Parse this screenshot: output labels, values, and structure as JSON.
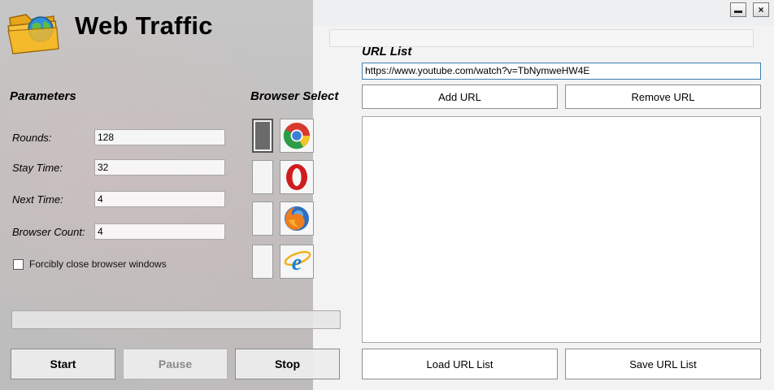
{
  "app": {
    "title": "Web Traffic"
  },
  "parameters": {
    "heading": "Parameters",
    "rounds_label": "Rounds:",
    "rounds_value": "128",
    "stay_label": "Stay Time:",
    "stay_value": "32",
    "next_label": "Next Time:",
    "next_value": "4",
    "count_label": "Browser Count:",
    "count_value": "4",
    "close_label": "Forcibly close browser windows",
    "close_checked": false
  },
  "progress": {
    "value": 0
  },
  "actions": {
    "start": "Start",
    "pause": "Pause",
    "stop": "Stop"
  },
  "browser_select": {
    "heading": "Browser Select",
    "browsers": [
      {
        "name": "Chrome",
        "icon": "chrome-icon",
        "selected": true
      },
      {
        "name": "Opera",
        "icon": "opera-icon",
        "selected": false
      },
      {
        "name": "Firefox",
        "icon": "firefox-icon",
        "selected": false
      },
      {
        "name": "Internet Explorer",
        "icon": "ie-icon",
        "selected": false
      }
    ]
  },
  "url_list": {
    "heading": "URL List",
    "input_value": "https://www.youtube.com/watch?v=TbNymweHW4E",
    "add": "Add URL",
    "remove": "Remove URL",
    "items": [],
    "load": "Load URL List",
    "save": "Save URL List"
  },
  "window": {
    "close_glyph": "×"
  },
  "colors": {
    "accent": "#3c7fb1",
    "toggle_on": "#6a6a6a"
  }
}
